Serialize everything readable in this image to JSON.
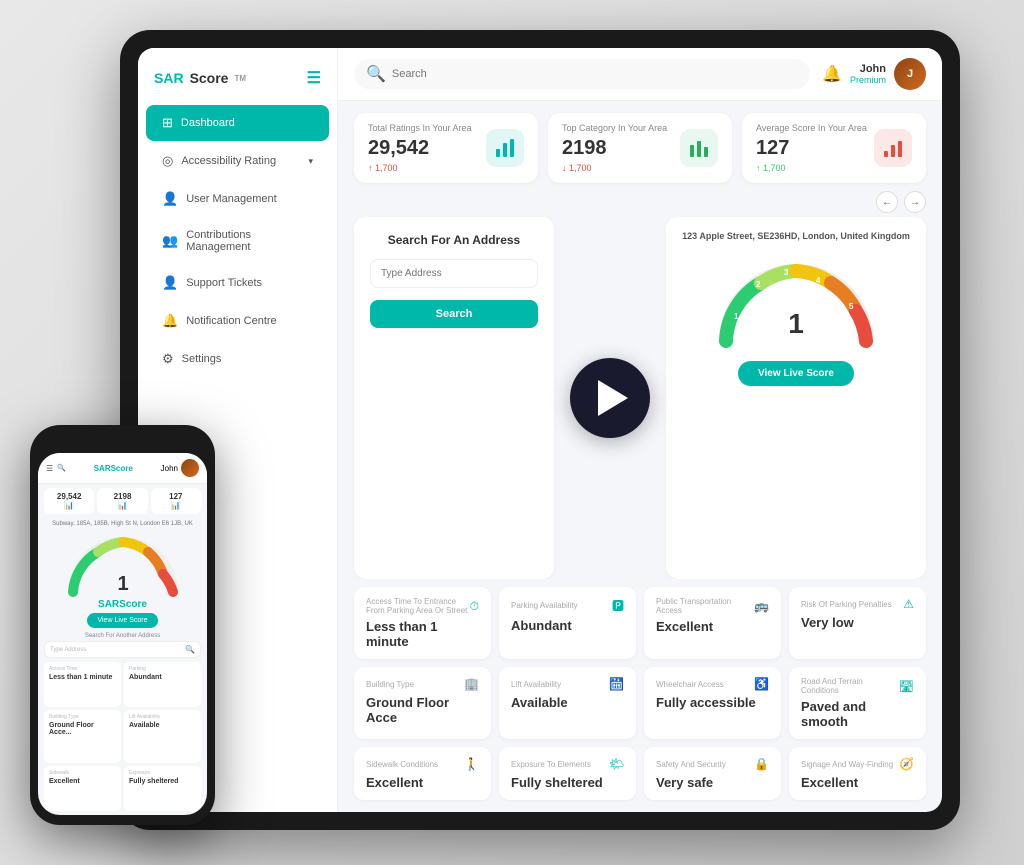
{
  "scene": {
    "tablet": {
      "sidebar": {
        "logo": "SARScore",
        "logo_tm": "TM",
        "nav_items": [
          {
            "id": "dashboard",
            "label": "Dashboard",
            "icon": "⊞",
            "active": true
          },
          {
            "id": "accessibility",
            "label": "Accessibility Rating",
            "icon": "◎",
            "chevron": "▾"
          },
          {
            "id": "user-mgmt",
            "label": "User Management",
            "icon": "👤",
            "active": false
          },
          {
            "id": "contributions",
            "label": "Contributions Management",
            "icon": "👥",
            "active": false
          },
          {
            "id": "support",
            "label": "Support Tickets",
            "icon": "👤",
            "active": false
          },
          {
            "id": "notifications",
            "label": "Notification Centre",
            "icon": "🔔",
            "active": false
          },
          {
            "id": "settings",
            "label": "Settings",
            "icon": "⚙",
            "active": false
          }
        ]
      },
      "header": {
        "search_placeholder": "Search",
        "user_name": "John",
        "user_plan": "Premium"
      },
      "stats": [
        {
          "label": "Total Ratings In Your Area",
          "value": "29,542",
          "change": "↑ 1,700",
          "change_type": "up",
          "icon": "📊",
          "icon_style": "teal"
        },
        {
          "label": "Top Category In Your Area",
          "value": "2198",
          "change": "↓ 1,700",
          "change_type": "down",
          "icon": "📊",
          "icon_style": "green"
        },
        {
          "label": "Average Score In Your Area",
          "value": "127",
          "change": "↑ 1,700",
          "change_type": "positive",
          "icon": "📊",
          "icon_style": "red"
        }
      ],
      "search_panel": {
        "title": "Search For An Address",
        "input_placeholder": "Type Address",
        "button_label": "Search"
      },
      "score_panel": {
        "address": "123 Apple Street, SE236HD, London, United Kingdom",
        "score": "1",
        "button_label": "View Live Score"
      },
      "grid_cards": [
        {
          "label": "Access Time To Entrance From Parking Area Or Street",
          "value": "Less than 1 minute",
          "icon": "⏱"
        },
        {
          "label": "Parking Availability",
          "value": "Abundant",
          "icon": "🅿"
        },
        {
          "label": "Public Transportation Access",
          "value": "Excellent",
          "icon": "🚌"
        },
        {
          "label": "Risk Of Parking Penalties",
          "value": "Very low",
          "icon": "⚠"
        },
        {
          "label": "Building Type",
          "value": "Ground Floor Acce",
          "icon": "🏢"
        },
        {
          "label": "Lift Availability",
          "value": "Available",
          "icon": "🛗"
        },
        {
          "label": "Wheelchair Access",
          "value": "Fully accessible",
          "icon": "♿"
        },
        {
          "label": "Road And Terrain Conditions",
          "value": "Paved and smooth",
          "icon": "🛣"
        },
        {
          "label": "Sidewalk Conditions",
          "value": "Excellent",
          "icon": "🚶"
        },
        {
          "label": "Exposure To Elements",
          "value": "Fully sheltered",
          "icon": "🌤"
        },
        {
          "label": "Safety And Security",
          "value": "Very safe",
          "icon": "🔒"
        },
        {
          "label": "Signage And Way-Finding",
          "value": "Excellent",
          "icon": "🧭"
        }
      ]
    },
    "phone": {
      "logo": "SARScore",
      "address": "Subway, 185A, 185B, High St N, London E6 1JB, UK",
      "stats": [
        {
          "value": "29,542",
          "icon": "📊"
        },
        {
          "value": "2198",
          "icon": "📊"
        },
        {
          "value": "127",
          "icon": "📊"
        }
      ],
      "view_btn": "View Live Score",
      "search_label": "Search For Another Address",
      "input_placeholder": "Type Address",
      "grid_cards": [
        {
          "label": "Access Time",
          "value": "Less than 1 minute"
        },
        {
          "label": "Parking",
          "value": "Abundant"
        },
        {
          "label": "Building Type",
          "value": "Ground Floor Acce..."
        },
        {
          "label": "Lift Availability",
          "value": "Available"
        },
        {
          "label": "Sidewalk",
          "value": "Excellent"
        },
        {
          "label": "Exposure",
          "value": "Fully sheltered"
        }
      ]
    }
  }
}
